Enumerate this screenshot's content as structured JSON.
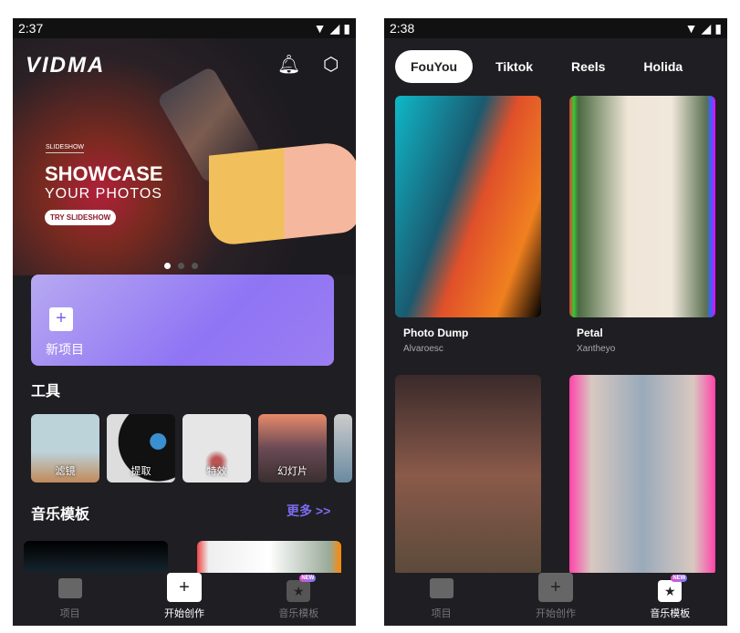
{
  "left": {
    "status": {
      "time": "2:37"
    },
    "header": {
      "logo": "VIDMA",
      "bell_icon": "bell-icon",
      "settings_icon": "hexagon-gear-icon"
    },
    "banner": {
      "tag": "SLIDESHOW",
      "title": "SHOWCASE",
      "subtitle": "YOUR PHOTOS",
      "cta": "TRY SLIDESHOW",
      "page": 1,
      "pages": 3
    },
    "new_project": {
      "label": "新项目",
      "icon": "plus-icon"
    },
    "tools": {
      "title": "工具",
      "items": [
        {
          "label": "滤镜"
        },
        {
          "label": "提取"
        },
        {
          "label": "特效"
        },
        {
          "label": "幻灯片"
        }
      ]
    },
    "music_templates": {
      "title": "音乐模板",
      "more": "更多 >>"
    },
    "nav": [
      {
        "label": "项目",
        "icon": "film-icon"
      },
      {
        "label": "开始创作",
        "icon": "plus-icon"
      },
      {
        "label": "音乐模板",
        "icon": "star-template-icon",
        "badge": "NEW"
      }
    ],
    "active_nav": 1
  },
  "right": {
    "status": {
      "time": "2:38"
    },
    "tabs": [
      {
        "label": "FouYou"
      },
      {
        "label": "Tiktok"
      },
      {
        "label": "Reels"
      },
      {
        "label": "Holida"
      }
    ],
    "cards": [
      {
        "title": "Photo Dump",
        "author": "Alvaroesc"
      },
      {
        "title": "Petal",
        "author": "Xantheyo"
      }
    ],
    "nav": [
      {
        "label": "项目"
      },
      {
        "label": "开始创作"
      },
      {
        "label": "音乐模板",
        "badge": "NEW"
      }
    ],
    "active_nav": 2
  },
  "colors": {
    "accent": "#7c6cf0",
    "background": "#1f1e23"
  }
}
